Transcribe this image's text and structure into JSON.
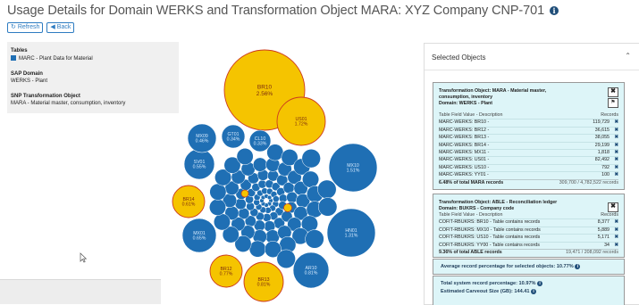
{
  "page": {
    "title": "Usage Details for Domain WERKS and Transformation Object MARA: XYZ Company CNP-701",
    "info_icon": "info-icon"
  },
  "toolbar": {
    "refresh_label": "Refresh",
    "back_label": "Back"
  },
  "left_panel": {
    "tables_heading": "Tables",
    "tables_item": "MARC - Plant Data for Material",
    "sap_domain_heading": "SAP Domain",
    "sap_domain_value": "WERKS - Plant",
    "snp_heading": "SNP Transformation Object",
    "snp_value": "MARA - Material master, consumption, inventory"
  },
  "colors": {
    "bubble_blue": "#1f6fb4",
    "bubble_yellow": "#f5c400",
    "yellow_border": "#cc3a1e",
    "card_bg": "#ddf5f8"
  },
  "bubbles": [
    {
      "name": "BR10",
      "value": "2.56%"
    },
    {
      "name": "US01",
      "value": "1.72%"
    },
    {
      "name": "MX10",
      "value": "1.51%"
    },
    {
      "name": "HN01",
      "value": "1.31%"
    },
    {
      "name": "BR13",
      "value": "0.81%"
    },
    {
      "name": "AR10",
      "value": "0.81%"
    },
    {
      "name": "BR12",
      "value": "0.77%"
    },
    {
      "name": "BR14",
      "value": "0.61%"
    },
    {
      "name": "MX01",
      "value": "0.65%"
    },
    {
      "name": "SV01",
      "value": "0.55%"
    },
    {
      "name": "MX09",
      "value": "0.46%"
    },
    {
      "name": "GT01",
      "value": "0.34%"
    },
    {
      "name": "CL10",
      "value": "0.33%"
    }
  ],
  "right_panel": {
    "title": "Selected Objects",
    "card1": {
      "title_line1": "Transformation Object: MARA - Material master,",
      "title_line2": "consumption, inventory",
      "title_line3": "Domain: WERKS - Plant",
      "col_desc": "Table Field Value - Description",
      "col_records": "Records",
      "rows": [
        {
          "desc": "MARC-WERKS: BR10 -",
          "records": "119,729"
        },
        {
          "desc": "MARC-WERKS: BR12 -",
          "records": "36,615"
        },
        {
          "desc": "MARC-WERKS: BR13 -",
          "records": "38,055"
        },
        {
          "desc": "MARC-WERKS: BR14 -",
          "records": "29,199"
        },
        {
          "desc": "MARC-WERKS: MX11 -",
          "records": "1,818"
        },
        {
          "desc": "MARC-WERKS: US01 -",
          "records": "82,492"
        },
        {
          "desc": "MARC-WERKS: US10 -",
          "records": "792"
        },
        {
          "desc": "MARC-WERKS: YY01 -",
          "records": "100"
        }
      ],
      "total_label": "6.48% of total MARA records",
      "total_value": "309,700 / 4,782,522 records"
    },
    "card2": {
      "title_line1": "Transformation Object: ABLE - Reconciliation ledger",
      "title_line2": "Domain: BUKRS - Company code",
      "col_desc": "Table Field Value - Description",
      "col_records": "Records",
      "rows": [
        {
          "desc": "COFIT-RBUKRS: BR10 - Table contains records",
          "records": "8,377"
        },
        {
          "desc": "COFIT-RBUKRS: MX10 - Table contains records",
          "records": "5,889"
        },
        {
          "desc": "COFIT-RBUKRS: US10 - Table contains records",
          "records": "5,171"
        },
        {
          "desc": "COFIT-RBUKRS: YY00 - Table contains records",
          "records": "34"
        }
      ],
      "total_label": "9.36% of total ABLE records",
      "total_value": "19,471 / 208,092 records"
    },
    "average_label": "Average record percentage for selected objects: 10.77%",
    "total_system_label": "Total system record percentage: 10.97%",
    "carveout_label": "Estimated Carveout Size (GB): 144.41"
  }
}
